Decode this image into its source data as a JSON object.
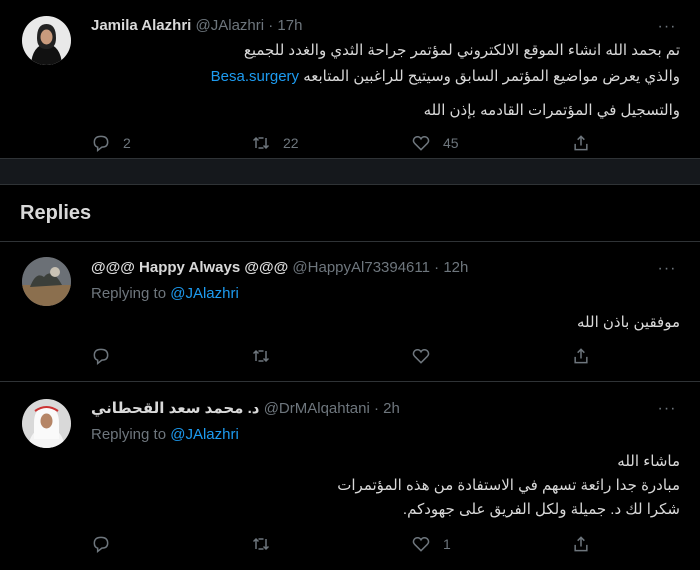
{
  "main_tweet": {
    "name": "Jamila Alazhri",
    "handle": "@JAlazhri",
    "time": "17h",
    "lines": [
      "تم بحمد الله انشاء الموقع الالكتروني لمؤتمر جراحة الثدي والغدد للجميع",
      "والذي يعرض مواضيع المؤتمر السابق وسيتيح للراغبين المتابعه",
      "والتسجيل في المؤتمرات القادمه بإذن الله"
    ],
    "link": "Besa.surgery",
    "reply_count": "2",
    "retweet_count": "22",
    "like_count": "45"
  },
  "section": {
    "title": "Replies"
  },
  "replies": [
    {
      "name": "@@@ Happy Always @@@",
      "handle": "@HappyAl73394611",
      "time": "12h",
      "replying_label": "Replying to",
      "replying_to": "@JAlazhri",
      "lines": [
        "موفقين باذن الله"
      ],
      "like_count": ""
    },
    {
      "name": "د. محمد سعد القحطاني",
      "handle": "@DrMAlqahtani",
      "time": "2h",
      "replying_label": "Replying to",
      "replying_to": "@JAlazhri",
      "lines": [
        "ماشاء الله",
        "مبادرة جدا رائعة تسهم في الاستفادة من هذه المؤتمرات",
        "شكرا لك د. جميلة ولكل الفريق على جهودكم."
      ],
      "like_count": "1"
    }
  ],
  "icons": {
    "reply": "reply-icon",
    "retweet": "retweet-icon",
    "like": "like-icon",
    "share": "share-icon",
    "more": "more-icon"
  },
  "colors": {
    "background": "#000000",
    "link": "#1d9bf0",
    "muted": "#6e767d",
    "divider_band": "#15181c"
  }
}
